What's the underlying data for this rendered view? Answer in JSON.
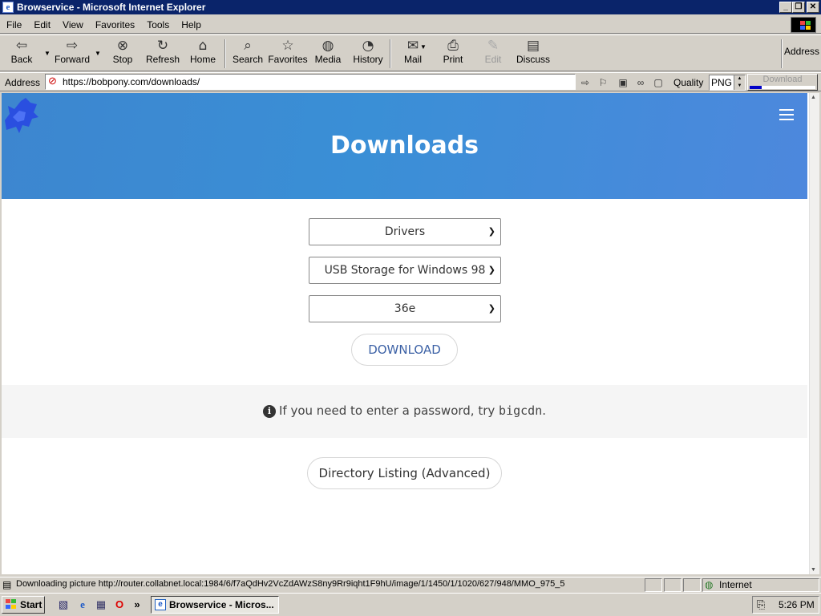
{
  "window": {
    "title": "Browservice - Microsoft Internet Explorer"
  },
  "menu": {
    "file": "File",
    "edit": "Edit",
    "view": "View",
    "favorites": "Favorites",
    "tools": "Tools",
    "help": "Help"
  },
  "toolbar": {
    "back": "Back",
    "forward": "Forward",
    "stop": "Stop",
    "refresh": "Refresh",
    "home": "Home",
    "search": "Search",
    "favorites": "Favorites",
    "media": "Media",
    "history": "History",
    "mail": "Mail",
    "print": "Print",
    "edit": "Edit",
    "discuss": "Discuss",
    "address": "Address"
  },
  "addressbar": {
    "label": "Address",
    "url": "https://bobpony.com/downloads/",
    "quality_label": "Quality",
    "quality_value": "PNG",
    "download_label": "Download",
    "download_progress": 0.18
  },
  "page": {
    "title": "Downloads",
    "select_category": "Drivers",
    "select_item": "USB Storage for Windows 98",
    "select_version": "36e",
    "download_button": "DOWNLOAD",
    "info_text": "If you need to enter a password, try",
    "info_code": "bigcdn",
    "info_period": ".",
    "directory_button": "Directory Listing (Advanced)"
  },
  "statusbar": {
    "text": "Downloading picture http://router.collabnet.local:1984/6/f7aQdHv2VcZdAWzS8ny9Rr9iqht1F9hU/image/1/1450/1/1020/627/948/MMO_975_5",
    "zone": "Internet"
  },
  "taskbar": {
    "start": "Start",
    "task_ie": "Browservice - Micros...",
    "clock": "5:26 PM",
    "chevron": "»"
  },
  "colors": {
    "hero_blue": "#3d86cf",
    "download_text": "#3d62a6",
    "titlebar": "#0a246a"
  }
}
